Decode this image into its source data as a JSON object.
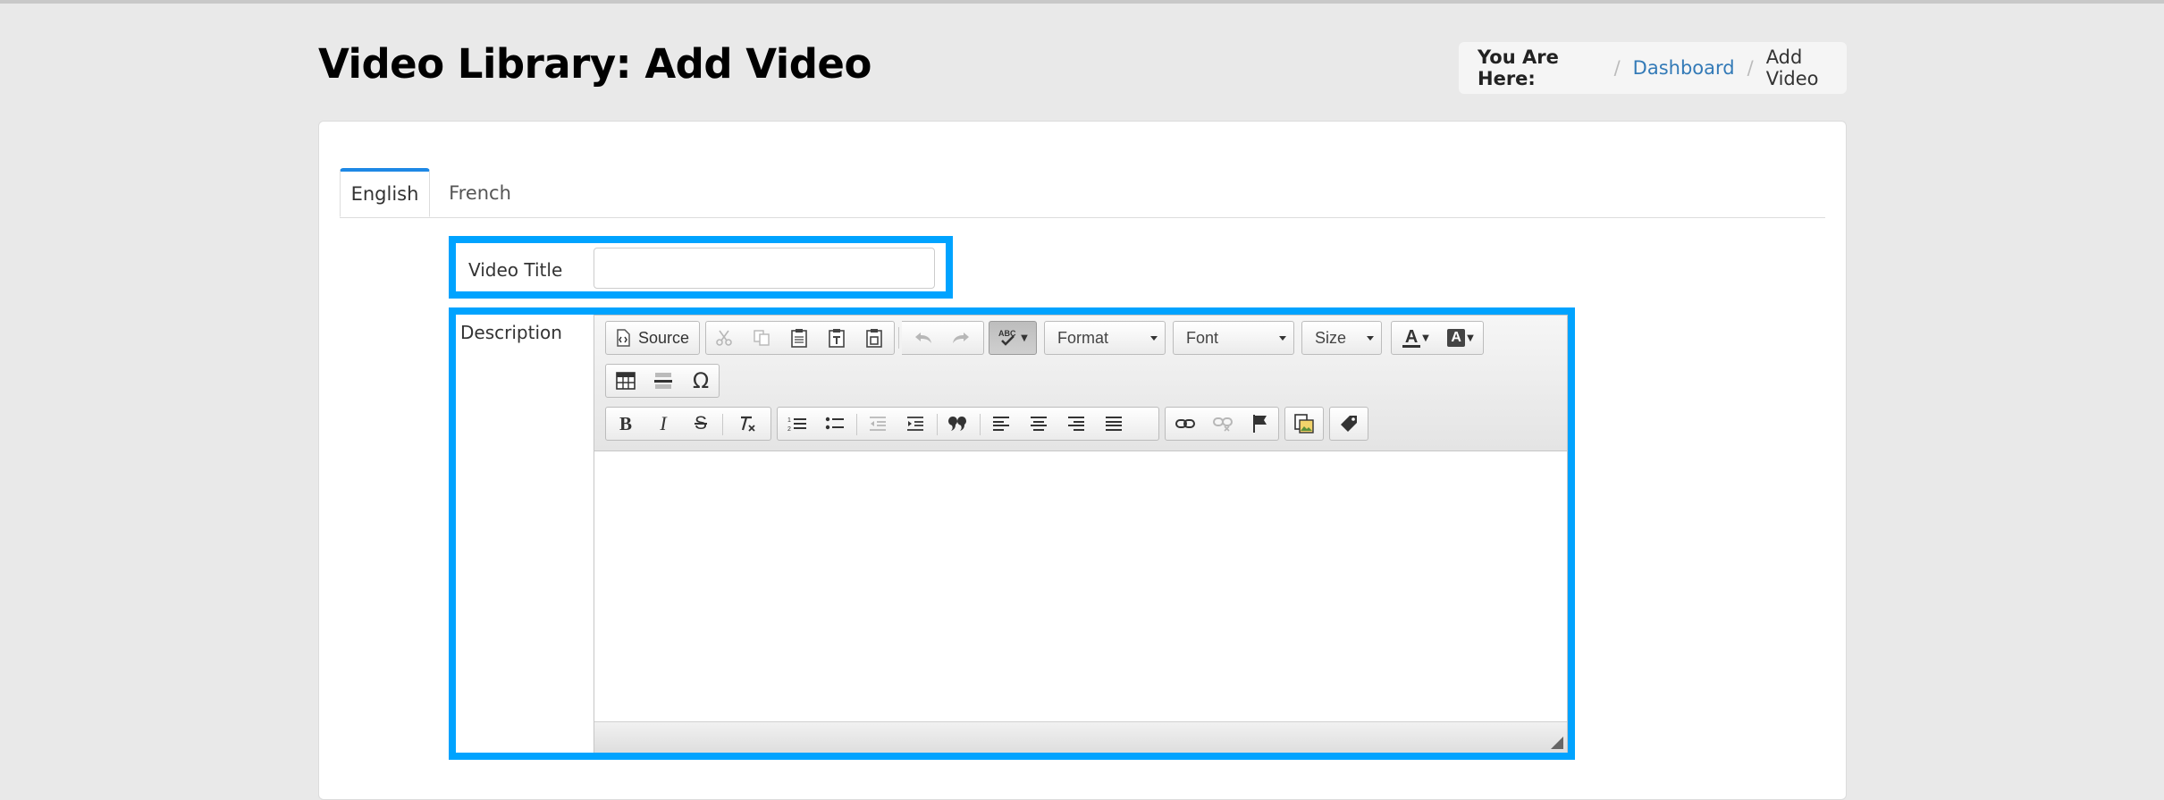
{
  "page": {
    "title": "Video Library: Add Video"
  },
  "breadcrumb": {
    "lead": "You Are Here:",
    "separator": "/",
    "link": "Dashboard",
    "current": "Add Video"
  },
  "tabs": [
    {
      "label": "English",
      "active": true
    },
    {
      "label": "French",
      "active": false
    }
  ],
  "form": {
    "title_label": "Video Title",
    "title_value": "",
    "description_label": "Description"
  },
  "editor": {
    "source_label": "Source",
    "format_label": "Format",
    "font_label": "Font",
    "size_label": "Size",
    "icons_row1": [
      "source-icon",
      "cut-icon",
      "copy-icon",
      "paste-icon",
      "paste-text-icon",
      "paste-word-icon",
      "undo-icon",
      "redo-icon",
      "spellcheck-icon"
    ],
    "icons_row2": [
      "table-icon",
      "horizontal-rule-icon",
      "special-char-icon"
    ],
    "icons_row3": [
      "bold-icon",
      "italic-icon",
      "strike-icon",
      "remove-format-icon",
      "numbered-list-icon",
      "bulleted-list-icon",
      "outdent-icon",
      "indent-icon",
      "blockquote-icon",
      "align-left-icon",
      "align-center-icon",
      "align-right-icon",
      "justify-icon",
      "link-icon",
      "unlink-icon",
      "anchor-icon",
      "image-icon",
      "tag-icon"
    ],
    "special_char_glyph": "Ω",
    "bold_glyph": "B",
    "italic_glyph": "I",
    "strike_glyph": "S",
    "text_color_glyph": "A",
    "bg_color_glyph": "A"
  },
  "colors": {
    "highlight": "#00a3ff",
    "tab_accent": "#1e88e5",
    "link": "#337ab7"
  }
}
